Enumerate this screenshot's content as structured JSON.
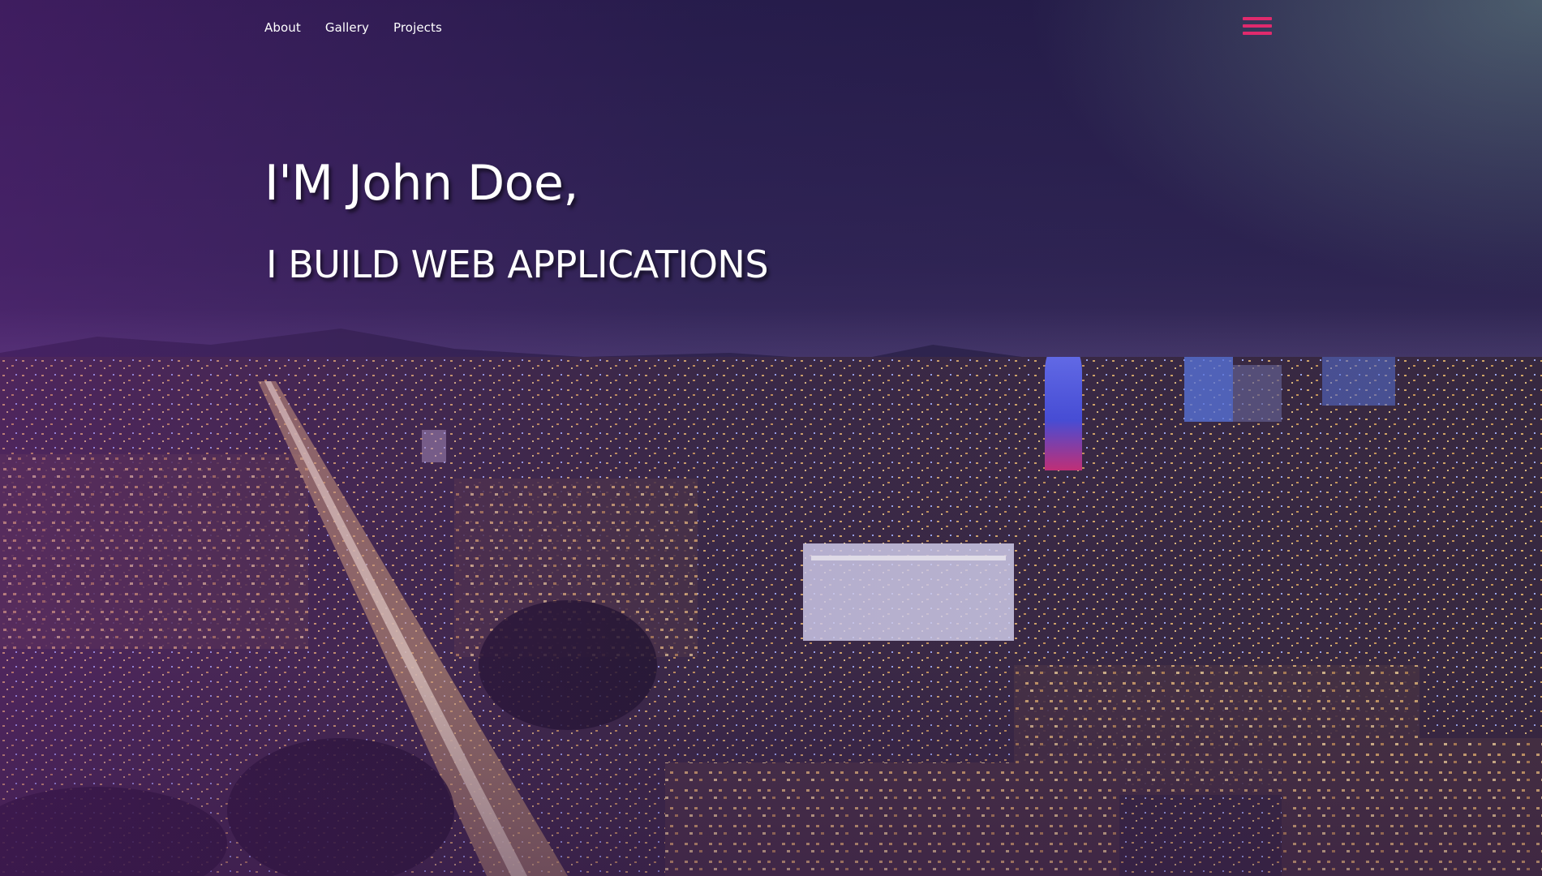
{
  "nav": {
    "items": [
      {
        "label": "About"
      },
      {
        "label": "Gallery"
      },
      {
        "label": "Projects"
      }
    ]
  },
  "menu": {
    "icon": "hamburger-menu-icon",
    "color": "#e02a6d"
  },
  "hero": {
    "headline": "I'M John Doe,",
    "subheadline": "I BUILD WEB APPLICATIONS",
    "background": "night-city-skyline-image",
    "overlay_color": "#6e1e8c"
  }
}
